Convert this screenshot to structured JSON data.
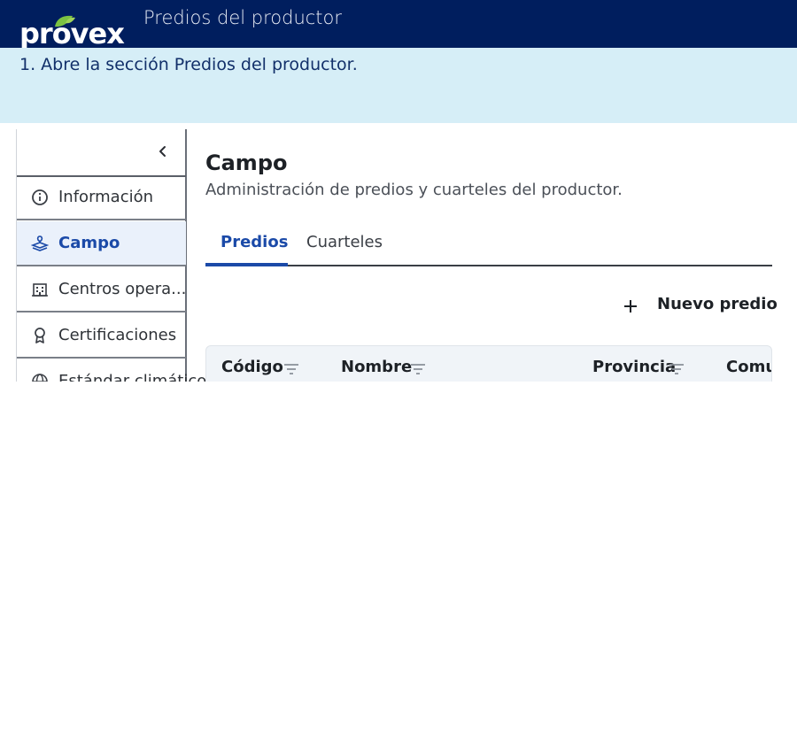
{
  "header": {
    "logo_text": "provex",
    "title": "Predios del productor",
    "bg_color": "#001e5e",
    "leaf_color": "#7cc242"
  },
  "step": {
    "text": "1. Abre la sección Predios del productor."
  },
  "sidebar": {
    "collapse_icon": "chevron-left-icon",
    "items": [
      {
        "label": "Información",
        "icon": "info-icon"
      },
      {
        "label": "Campo",
        "icon": "field-icon",
        "active": true
      },
      {
        "label": "Centros opera...",
        "icon": "building-icon"
      },
      {
        "label": "Certificaciones",
        "icon": "award-icon"
      },
      {
        "label": "Estándar climático",
        "icon": "globe-icon"
      }
    ]
  },
  "main": {
    "title": "Campo",
    "subtitle": "Administración de predios y cuarteles del productor.",
    "tabs": [
      {
        "label": "Predios",
        "active": true
      },
      {
        "label": "Cuarteles"
      }
    ],
    "new_button": "Nuevo predio",
    "table": {
      "columns": [
        "Código",
        "Nombre",
        "Provincia",
        "Comuna"
      ]
    },
    "accent_color": "#1b4aa8"
  }
}
